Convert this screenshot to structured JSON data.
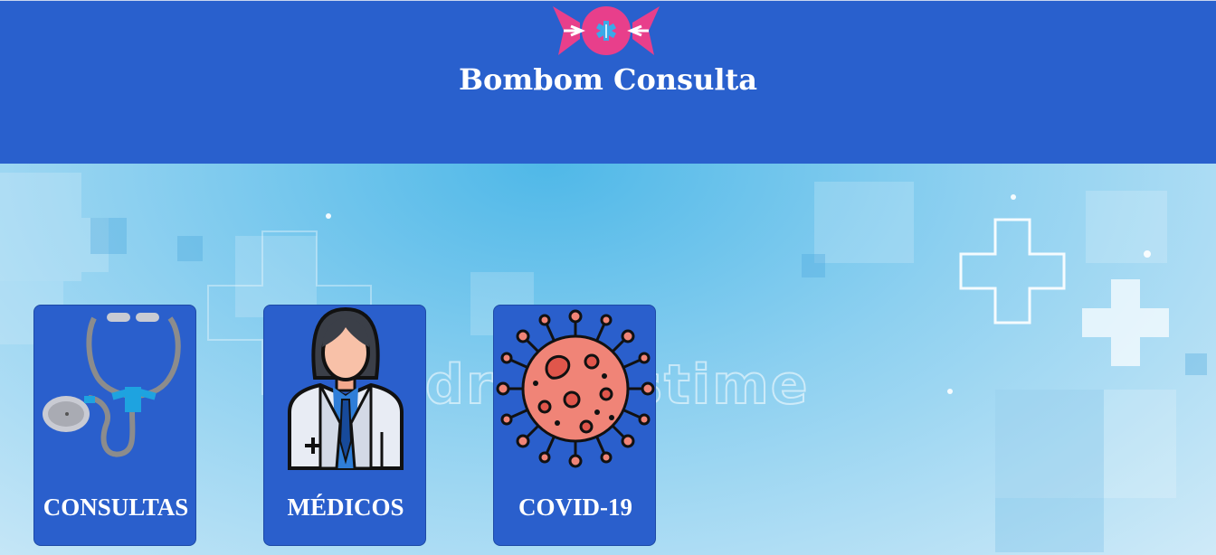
{
  "header": {
    "brand": "Bombom Consulta",
    "logo_icon": "candy-logo-icon",
    "background_color": "#2960cd",
    "logo_color": "#e83f8b"
  },
  "hero": {
    "watermark": "dreamstime"
  },
  "cards": [
    {
      "label": "CONSULTAS",
      "icon": "stethoscope-icon"
    },
    {
      "label": "MÉDICOS",
      "icon": "doctor-icon"
    },
    {
      "label": "COVID-19",
      "icon": "virus-icon"
    }
  ],
  "colors": {
    "card_background": "#2a5fcc",
    "text": "#ffffff"
  }
}
